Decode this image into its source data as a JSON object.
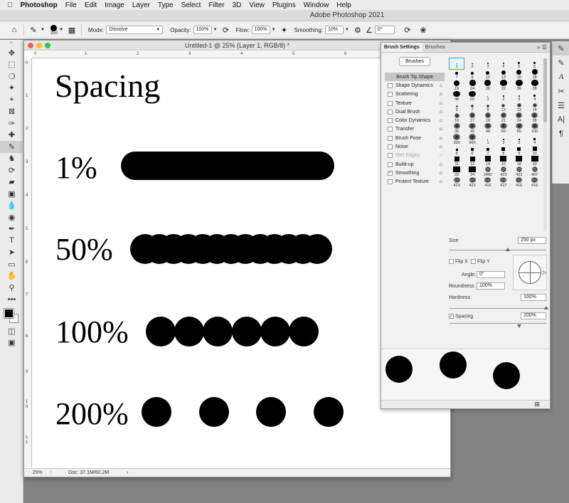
{
  "menu": {
    "apple": "",
    "app": "Photoshop",
    "items": [
      "File",
      "Edit",
      "Image",
      "Layer",
      "Type",
      "Select",
      "Filter",
      "3D",
      "View",
      "Plugins",
      "Window",
      "Help"
    ]
  },
  "app_title": "Adobe Photoshop 2021",
  "options": {
    "brush_size": "250",
    "mode_label": "Mode:",
    "mode_value": "Dissolve",
    "opacity_label": "Opacity:",
    "opacity_value": "100%",
    "flow_label": "Flow:",
    "flow_value": "100%",
    "smoothing_label": "Smoothing:",
    "smoothing_value": "10%",
    "angle_value": "0°"
  },
  "document": {
    "title": "Untitled-1 @ 25% (Layer 1, RGB/8) *",
    "zoom": "25%",
    "doc_info": "Doc: 37.1M/60.2M",
    "heading": "Spacing",
    "row_labels": [
      "1%",
      "50%",
      "100%",
      "200%"
    ],
    "hruler": [
      "0",
      "1",
      "2",
      "3",
      "4",
      "5",
      "6",
      "7"
    ],
    "vruler": [
      "0",
      "1",
      "2",
      "3",
      "4",
      "5",
      "6",
      "7",
      "8",
      "9",
      "1\n0",
      "1\n1"
    ]
  },
  "brush_panel": {
    "tabs": [
      "Brush Settings",
      "Brushes"
    ],
    "brushes_button": "Brushes",
    "options": [
      {
        "label": "Brush Tip Shape",
        "head": true
      },
      {
        "label": "Shape Dynamics",
        "checked": false,
        "lock": true
      },
      {
        "label": "Scattering",
        "checked": false,
        "lock": true
      },
      {
        "label": "Texture",
        "checked": false,
        "lock": true
      },
      {
        "label": "Dual Brush",
        "checked": false,
        "lock": true
      },
      {
        "label": "Color Dynamics",
        "checked": false,
        "lock": true
      },
      {
        "label": "Transfer",
        "checked": false,
        "lock": true
      },
      {
        "label": "Brush Pose",
        "checked": false,
        "lock": true
      },
      {
        "label": "Noise",
        "checked": false,
        "lock": true
      },
      {
        "label": "Wet Edges",
        "checked": false,
        "lock": true,
        "disabled": true
      },
      {
        "label": "Build-up",
        "checked": false,
        "lock": true
      },
      {
        "label": "Smoothing",
        "checked": true,
        "lock": true
      },
      {
        "label": "Protect Texture",
        "checked": false,
        "lock": true
      }
    ],
    "tips": [
      {
        "n": "1",
        "s": 1,
        "t": "round"
      },
      {
        "n": "2",
        "s": 1.5,
        "t": "round"
      },
      {
        "n": "3",
        "s": 2,
        "t": "round"
      },
      {
        "n": "4",
        "s": 2.5,
        "t": "round"
      },
      {
        "n": "5",
        "s": 3,
        "t": "round"
      },
      {
        "n": "6",
        "s": 3.5,
        "t": "round"
      },
      {
        "n": "7",
        "s": 4,
        "t": "round"
      },
      {
        "n": "9",
        "s": 4.5,
        "t": "round"
      },
      {
        "n": "12",
        "s": 5,
        "t": "round"
      },
      {
        "n": "13",
        "s": 6,
        "t": "round"
      },
      {
        "n": "16",
        "s": 7,
        "t": "round"
      },
      {
        "n": "18",
        "s": 8,
        "t": "round"
      },
      {
        "n": "19",
        "s": 8,
        "t": "round"
      },
      {
        "n": "24",
        "s": 9,
        "t": "round"
      },
      {
        "n": "28",
        "s": 9,
        "t": "round"
      },
      {
        "n": "32",
        "s": 10,
        "t": "round"
      },
      {
        "n": "36",
        "s": 10,
        "t": "round"
      },
      {
        "n": "38",
        "s": 10,
        "t": "round"
      },
      {
        "n": "48",
        "s": 10,
        "t": "round"
      },
      {
        "n": "60",
        "s": 10,
        "t": "round"
      },
      {
        "n": "1",
        "s": 1,
        "t": "round"
      },
      {
        "n": "2",
        "s": 1.5,
        "t": "round"
      },
      {
        "n": "3",
        "s": 2,
        "t": "round"
      },
      {
        "n": "4",
        "s": 2.5,
        "t": "round"
      },
      {
        "n": "5",
        "s": 3,
        "t": "soft"
      },
      {
        "n": "7",
        "s": 4,
        "t": "soft"
      },
      {
        "n": "9",
        "s": 4,
        "t": "soft"
      },
      {
        "n": "12",
        "s": 5,
        "t": "soft"
      },
      {
        "n": "13",
        "s": 6,
        "t": "soft"
      },
      {
        "n": "14",
        "s": 6,
        "t": "soft"
      },
      {
        "n": "16",
        "s": 7,
        "t": "soft"
      },
      {
        "n": "17",
        "s": 8,
        "t": "soft"
      },
      {
        "n": "18",
        "s": 8,
        "t": "soft"
      },
      {
        "n": "21",
        "s": 8,
        "t": "soft"
      },
      {
        "n": "24",
        "s": 9,
        "t": "soft"
      },
      {
        "n": "28",
        "s": 9,
        "t": "soft"
      },
      {
        "n": "35",
        "s": 9,
        "t": "soft"
      },
      {
        "n": "45",
        "s": 10,
        "t": "soft"
      },
      {
        "n": "48",
        "s": 10,
        "t": "soft"
      },
      {
        "n": "60",
        "s": 10,
        "t": "soft"
      },
      {
        "n": "65",
        "s": 10,
        "t": "soft"
      },
      {
        "n": "100",
        "s": 10,
        "t": "soft"
      },
      {
        "n": "300",
        "s": 10,
        "t": "soft"
      },
      {
        "n": "500",
        "s": 10,
        "t": "soft"
      },
      {
        "n": "1",
        "s": 1,
        "t": "square"
      },
      {
        "n": "2",
        "s": 1.5,
        "t": "square"
      },
      {
        "n": "3",
        "s": 2,
        "t": "square"
      },
      {
        "n": "4",
        "s": 3,
        "t": "square"
      },
      {
        "n": "5",
        "s": 3,
        "t": "square"
      },
      {
        "n": "6",
        "s": 4,
        "t": "square"
      },
      {
        "n": "7",
        "s": 4,
        "t": "square"
      },
      {
        "n": "8",
        "s": 5,
        "t": "square"
      },
      {
        "n": "9",
        "s": 5,
        "t": "square"
      },
      {
        "n": "10",
        "s": 6,
        "t": "square"
      },
      {
        "n": "11",
        "s": 7,
        "t": "square"
      },
      {
        "n": "12",
        "s": 7,
        "t": "square"
      },
      {
        "n": "14",
        "s": 8,
        "t": "square"
      },
      {
        "n": "16",
        "s": 9,
        "t": "square"
      },
      {
        "n": "18",
        "s": 9,
        "t": "square"
      },
      {
        "n": "20",
        "s": 10,
        "t": "square"
      },
      {
        "n": "22",
        "s": 10,
        "t": "square"
      },
      {
        "n": "24",
        "s": 10,
        "t": "square"
      },
      {
        "n": "2482",
        "s": 8,
        "t": "tex"
      },
      {
        "n": "423",
        "s": 8,
        "t": "tex"
      },
      {
        "n": "423",
        "s": 8,
        "t": "tex"
      },
      {
        "n": "407",
        "s": 8,
        "t": "tex"
      },
      {
        "n": "423",
        "s": 9,
        "t": "tex"
      },
      {
        "n": "423",
        "s": 9,
        "t": "tex"
      },
      {
        "n": "416",
        "s": 9,
        "t": "tex"
      },
      {
        "n": "417",
        "s": 9,
        "t": "tex"
      },
      {
        "n": "416",
        "s": 9,
        "t": "tex"
      },
      {
        "n": "416",
        "s": 9,
        "t": "tex"
      }
    ],
    "size_label": "Size",
    "size_value": "250 px",
    "size_fraction": 0.6,
    "flipx_label": "Flip X",
    "flipy_label": "Flip Y",
    "angle_label": "Angle:",
    "angle_value": "0°",
    "roundness_label": "Roundness:",
    "roundness_value": "100%",
    "hardness_label": "Hardness",
    "hardness_value": "100%",
    "hardness_fraction": 1.0,
    "spacing_label": "Spacing",
    "spacing_value": "200%",
    "spacing_fraction": 0.72
  }
}
